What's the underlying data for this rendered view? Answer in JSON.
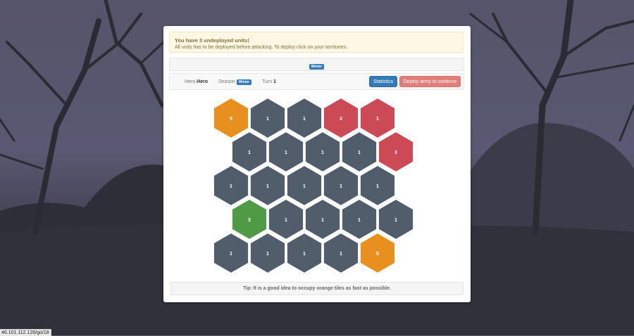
{
  "alert": {
    "title": "You have 3 undeployed units!",
    "message": "All units has to be deployed before attacking. To deploy click on your territories."
  },
  "season_banner": "Winter",
  "info": {
    "hero_label": "Hero",
    "hero_value": "Hero",
    "season_label": "Season",
    "season_value": "Winter",
    "turn_label": "Turn",
    "turn_value": "1"
  },
  "buttons": {
    "statistics": "Statistics",
    "deploy": "Deploy army to continue"
  },
  "tip": "Tip: It is a good idea to occupy orange tiles as fast as possible.",
  "status_url": "46.101.112.126/go/18",
  "colors": {
    "neutral": "#525d6b",
    "orange": "#e8901f",
    "red": "#cc4a55",
    "green": "#4e9a45",
    "primary": "#337ab7",
    "deploy": "#e17e7a"
  },
  "board": {
    "rows": [
      {
        "row": 0,
        "tiles": [
          {
            "col": 0,
            "owner": "orange",
            "units": "5"
          },
          {
            "col": 1,
            "owner": "neutral",
            "units": "1"
          },
          {
            "col": 2,
            "owner": "neutral",
            "units": "1"
          },
          {
            "col": 3,
            "owner": "red",
            "units": "3"
          },
          {
            "col": 4,
            "owner": "red",
            "units": "1"
          }
        ]
      },
      {
        "row": 1,
        "tiles": [
          {
            "col": 0,
            "owner": "neutral",
            "units": "1"
          },
          {
            "col": 1,
            "owner": "neutral",
            "units": "1"
          },
          {
            "col": 2,
            "owner": "neutral",
            "units": "1"
          },
          {
            "col": 3,
            "owner": "neutral",
            "units": "1"
          },
          {
            "col": 4,
            "owner": "red",
            "units": "3"
          }
        ]
      },
      {
        "row": 2,
        "tiles": [
          {
            "col": 0,
            "owner": "neutral",
            "units": "1"
          },
          {
            "col": 1,
            "owner": "neutral",
            "units": "1"
          },
          {
            "col": 2,
            "owner": "neutral",
            "units": "1"
          },
          {
            "col": 3,
            "owner": "neutral",
            "units": "1"
          },
          {
            "col": 4,
            "owner": "neutral",
            "units": "1"
          }
        ]
      },
      {
        "row": 3,
        "tiles": [
          {
            "col": 0,
            "owner": "green",
            "units": "3"
          },
          {
            "col": 1,
            "owner": "neutral",
            "units": "1"
          },
          {
            "col": 2,
            "owner": "neutral",
            "units": "1"
          },
          {
            "col": 3,
            "owner": "neutral",
            "units": "1"
          },
          {
            "col": 4,
            "owner": "neutral",
            "units": "1"
          }
        ]
      },
      {
        "row": 4,
        "tiles": [
          {
            "col": 0,
            "owner": "neutral",
            "units": "1"
          },
          {
            "col": 1,
            "owner": "neutral",
            "units": "1"
          },
          {
            "col": 2,
            "owner": "neutral",
            "units": "1"
          },
          {
            "col": 3,
            "owner": "neutral",
            "units": "1"
          },
          {
            "col": 4,
            "owner": "orange",
            "units": "5"
          }
        ]
      }
    ]
  }
}
